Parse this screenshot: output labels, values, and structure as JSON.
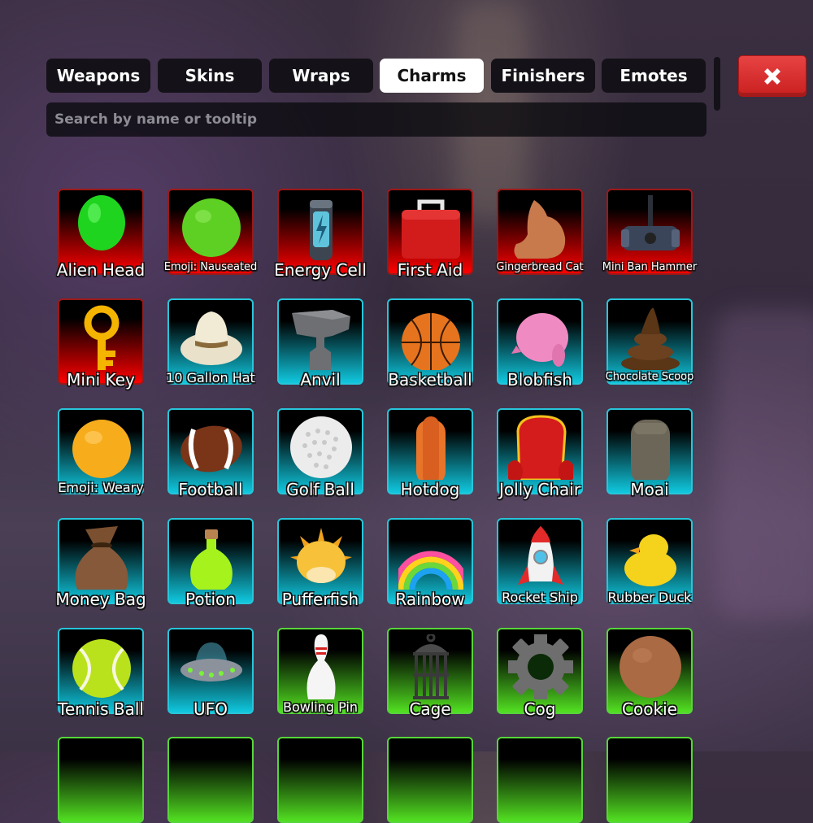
{
  "tabs": [
    {
      "label": "Weapons",
      "active": false
    },
    {
      "label": "Skins",
      "active": false
    },
    {
      "label": "Wraps",
      "active": false
    },
    {
      "label": "Charms",
      "active": true
    },
    {
      "label": "Finishers",
      "active": false
    },
    {
      "label": "Emotes",
      "active": false
    }
  ],
  "close_button": {
    "icon": "x-icon"
  },
  "search": {
    "placeholder": "Search by name or tooltip",
    "value": ""
  },
  "rarity_colors": {
    "red": "#ff0000",
    "blue": "#10c8df",
    "green": "#52e021"
  },
  "items": [
    {
      "name": "Alien Head",
      "rarity": "red",
      "icon": "balloon-icon"
    },
    {
      "name": "Emoji: Nauseated",
      "rarity": "red",
      "icon": "green-ball-icon"
    },
    {
      "name": "Energy Cell",
      "rarity": "red",
      "icon": "battery-icon"
    },
    {
      "name": "First Aid",
      "rarity": "red",
      "icon": "first-aid-kit-icon"
    },
    {
      "name": "Gingerbread Cat",
      "rarity": "red",
      "icon": "cat-icon"
    },
    {
      "name": "Mini Ban Hammer",
      "rarity": "red",
      "icon": "hammer-icon"
    },
    {
      "name": "Mini Key",
      "rarity": "red",
      "icon": "key-icon"
    },
    {
      "name": "10 Gallon Hat",
      "rarity": "blue",
      "icon": "cowboy-hat-icon"
    },
    {
      "name": "Anvil",
      "rarity": "blue",
      "icon": "anvil-icon"
    },
    {
      "name": "Basketball",
      "rarity": "blue",
      "icon": "basketball-icon"
    },
    {
      "name": "Blobfish",
      "rarity": "blue",
      "icon": "blobfish-icon"
    },
    {
      "name": "Chocolate Scoop",
      "rarity": "blue",
      "icon": "chocolate-icon"
    },
    {
      "name": "Emoji: Weary",
      "rarity": "blue",
      "icon": "yellow-ball-icon"
    },
    {
      "name": "Football",
      "rarity": "blue",
      "icon": "football-icon"
    },
    {
      "name": "Golf Ball",
      "rarity": "blue",
      "icon": "golf-ball-icon"
    },
    {
      "name": "Hotdog",
      "rarity": "blue",
      "icon": "hotdog-icon"
    },
    {
      "name": "Jolly Chair",
      "rarity": "blue",
      "icon": "chair-icon"
    },
    {
      "name": "Moai",
      "rarity": "blue",
      "icon": "moai-icon"
    },
    {
      "name": "Money Bag",
      "rarity": "blue",
      "icon": "money-bag-icon"
    },
    {
      "name": "Potion",
      "rarity": "blue",
      "icon": "potion-icon"
    },
    {
      "name": "Pufferfish",
      "rarity": "blue",
      "icon": "pufferfish-icon"
    },
    {
      "name": "Rainbow",
      "rarity": "blue",
      "icon": "rainbow-icon"
    },
    {
      "name": "Rocket Ship",
      "rarity": "blue",
      "icon": "rocket-icon"
    },
    {
      "name": "Rubber Duck",
      "rarity": "blue",
      "icon": "duck-icon"
    },
    {
      "name": "Tennis Ball",
      "rarity": "blue",
      "icon": "tennis-ball-icon"
    },
    {
      "name": "UFO",
      "rarity": "blue",
      "icon": "ufo-icon"
    },
    {
      "name": "Bowling Pin",
      "rarity": "green",
      "icon": "bowling-pin-icon"
    },
    {
      "name": "Cage",
      "rarity": "green",
      "icon": "cage-icon"
    },
    {
      "name": "Cog",
      "rarity": "green",
      "icon": "cog-icon"
    },
    {
      "name": "Cookie",
      "rarity": "green",
      "icon": "cookie-icon"
    }
  ]
}
